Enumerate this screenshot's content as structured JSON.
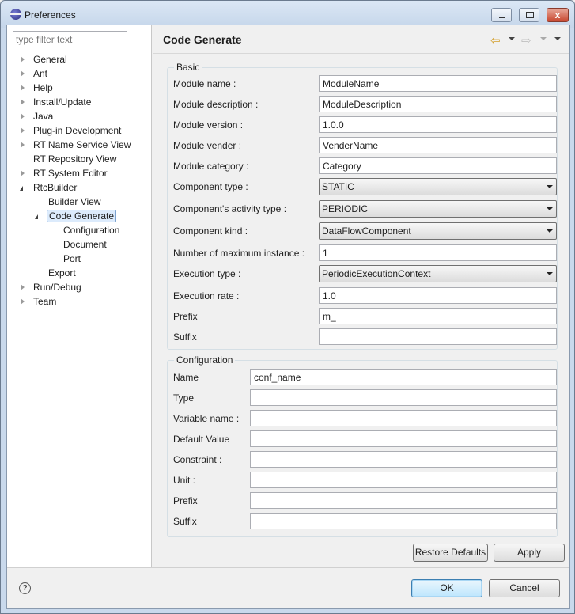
{
  "window": {
    "title": "Preferences",
    "close_label": "x"
  },
  "filter": {
    "placeholder": "type filter text"
  },
  "tree": [
    {
      "label": "General",
      "expandable": true
    },
    {
      "label": "Ant",
      "expandable": true
    },
    {
      "label": "Help",
      "expandable": true
    },
    {
      "label": "Install/Update",
      "expandable": true
    },
    {
      "label": "Java",
      "expandable": true
    },
    {
      "label": "Plug-in Development",
      "expandable": true
    },
    {
      "label": "RT Name Service View",
      "expandable": true
    },
    {
      "label": "RT Repository View",
      "expandable": false
    },
    {
      "label": "RT System Editor",
      "expandable": true
    },
    {
      "label": "RtcBuilder",
      "expandable": true,
      "expanded": true
    },
    {
      "label": "Builder View",
      "expandable": false
    },
    {
      "label": "Code Generate",
      "expandable": true,
      "expanded": true,
      "selected": true
    },
    {
      "label": "Configuration",
      "expandable": false
    },
    {
      "label": "Document",
      "expandable": false
    },
    {
      "label": "Port",
      "expandable": false
    },
    {
      "label": "Export",
      "expandable": false
    },
    {
      "label": "Run/Debug",
      "expandable": true
    },
    {
      "label": "Team",
      "expandable": true
    }
  ],
  "page": {
    "title": "Code Generate"
  },
  "basic": {
    "legend": "Basic",
    "rows": [
      {
        "label": "Module name :",
        "kind": "text",
        "value": "ModuleName"
      },
      {
        "label": "Module description :",
        "kind": "text",
        "value": "ModuleDescription"
      },
      {
        "label": "Module version :",
        "kind": "text",
        "value": "1.0.0"
      },
      {
        "label": "Module vender :",
        "kind": "text",
        "value": "VenderName"
      },
      {
        "label": "Module category :",
        "kind": "text",
        "value": "Category"
      },
      {
        "label": "Component type :",
        "kind": "combo",
        "value": "STATIC"
      },
      {
        "label": "Component's activity type :",
        "kind": "combo",
        "value": "PERIODIC"
      },
      {
        "label": "Component kind :",
        "kind": "combo",
        "value": "DataFlowComponent"
      },
      {
        "label": "Number of maximum instance :",
        "kind": "text",
        "value": "1"
      },
      {
        "label": "Execution type :",
        "kind": "combo",
        "value": "PeriodicExecutionContext"
      },
      {
        "label": "Execution rate :",
        "kind": "text",
        "value": "1.0"
      },
      {
        "label": "Prefix",
        "kind": "text",
        "value": "m_"
      },
      {
        "label": "Suffix",
        "kind": "text",
        "value": ""
      }
    ]
  },
  "configuration": {
    "legend": "Configuration",
    "rows": [
      {
        "label": "Name",
        "value": "conf_name"
      },
      {
        "label": "Type",
        "value": ""
      },
      {
        "label": "Variable name :",
        "value": ""
      },
      {
        "label": "Default Value",
        "value": ""
      },
      {
        "label": "Constraint :",
        "value": ""
      },
      {
        "label": "Unit :",
        "value": ""
      },
      {
        "label": "Prefix",
        "value": ""
      },
      {
        "label": "Suffix",
        "value": ""
      }
    ]
  },
  "buttons": {
    "restore_defaults": "Restore Defaults",
    "apply": "Apply",
    "ok": "OK",
    "cancel": "Cancel",
    "help": "?"
  }
}
